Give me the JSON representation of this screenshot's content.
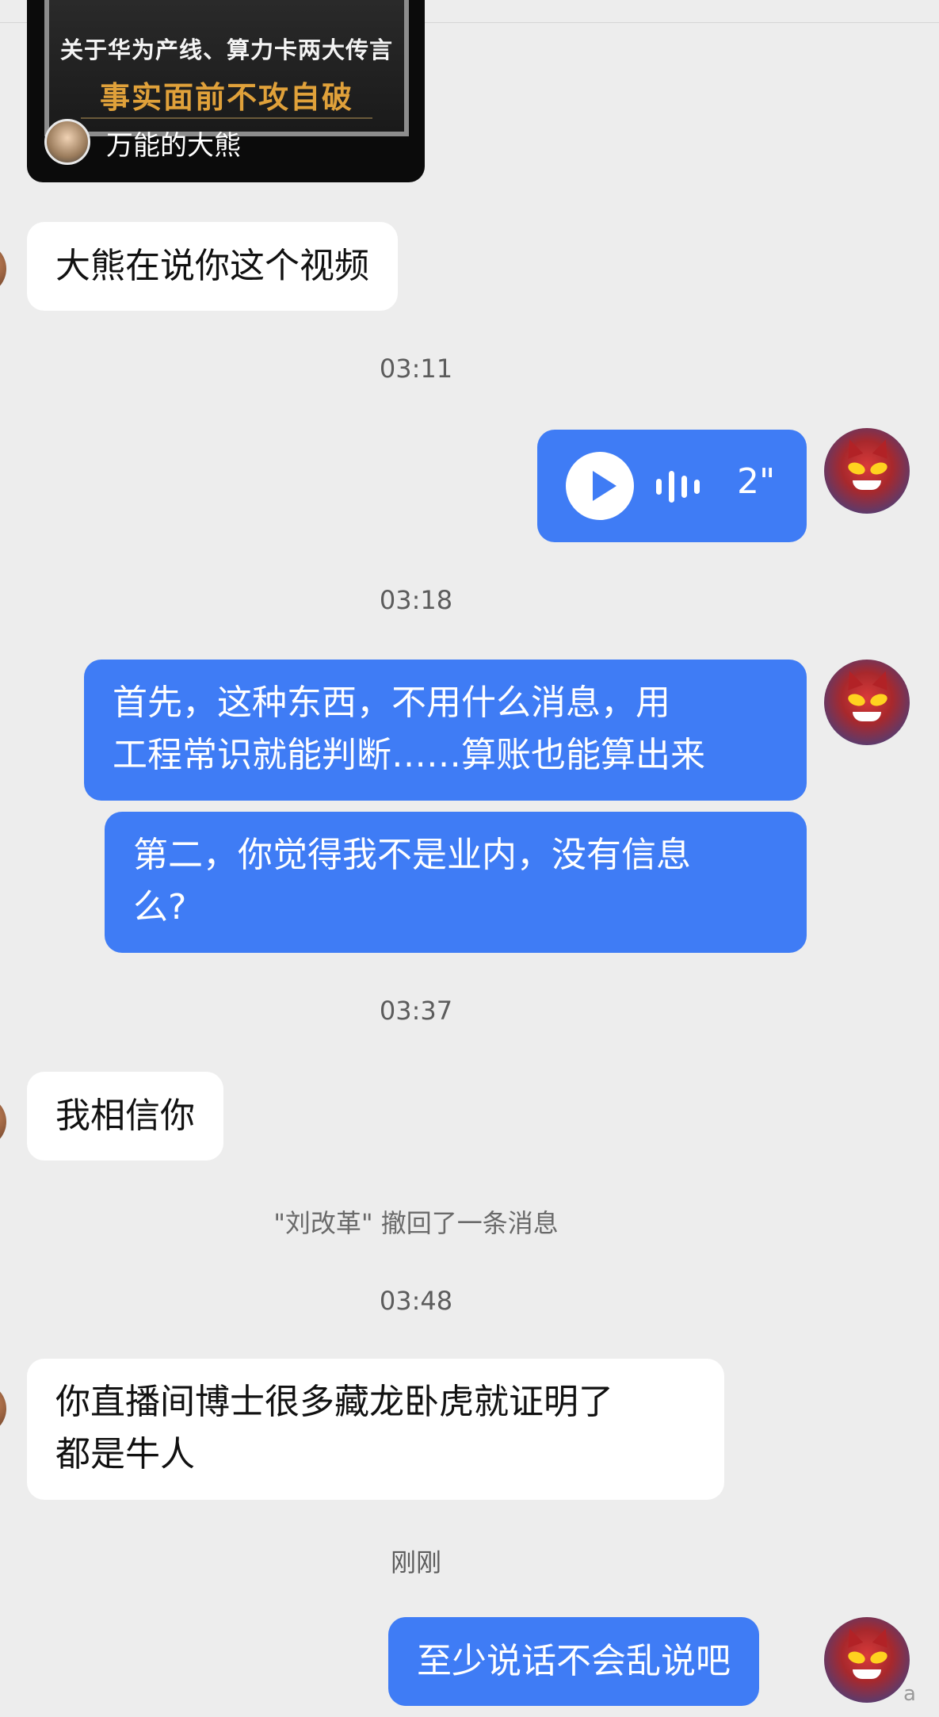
{
  "video_card": {
    "title_line1": "关于华为产线、算力卡两大传言",
    "title_line2": "事实面前不攻自破",
    "author": "万能的大熊"
  },
  "messages": [
    {
      "type": "in",
      "text": "大熊在说你这个视频"
    },
    {
      "type": "time",
      "text": "03:11"
    },
    {
      "type": "voice_out",
      "duration": "2\""
    },
    {
      "type": "time",
      "text": "03:18"
    },
    {
      "type": "out",
      "lines": [
        "首先，这种东西，不用什么消息，用",
        "工程常识就能判断……算账也能算出来"
      ]
    },
    {
      "type": "out",
      "lines": [
        "第二，你觉得我不是业内，没有信息",
        "么?"
      ]
    },
    {
      "type": "time",
      "text": "03:37"
    },
    {
      "type": "in",
      "text": "我相信你"
    },
    {
      "type": "system",
      "text": "\"刘改革\" 撤回了一条消息"
    },
    {
      "type": "time",
      "text": "03:48"
    },
    {
      "type": "in",
      "lines": [
        "你直播间博士很多藏龙卧虎就证明了",
        "都是牛人"
      ]
    },
    {
      "type": "time",
      "text": "刚刚"
    },
    {
      "type": "out",
      "text": "至少说话不会乱说吧"
    }
  ],
  "watermark": "a",
  "colors": {
    "background": "#ededed",
    "outgoing_bubble": "#3f7cf5",
    "incoming_bubble": "#ffffff"
  }
}
